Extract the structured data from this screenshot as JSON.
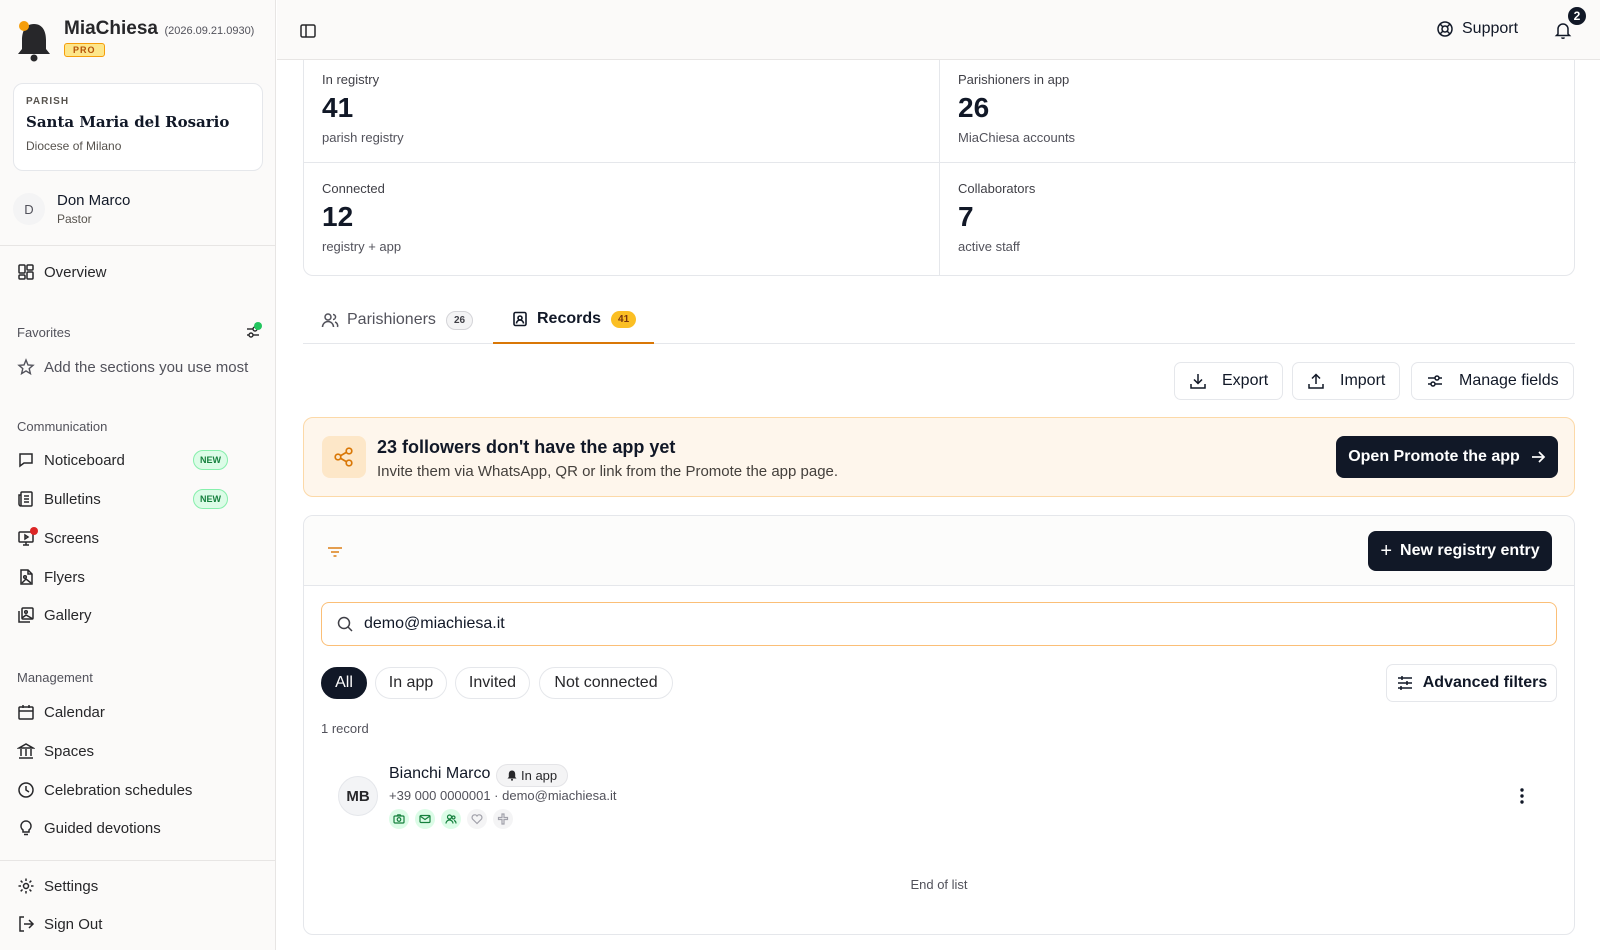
{
  "brand": {
    "name": "MiaChiesa",
    "version": "(2026.09.21.0930)",
    "tier": "PRO"
  },
  "parish": {
    "kicker": "PARISH",
    "name": "Santa Maria del Rosario",
    "diocese": "Diocese of Milano"
  },
  "user": {
    "initial": "D",
    "name": "Don Marco",
    "role": "Pastor"
  },
  "sidebar": {
    "overview": "Overview",
    "favorites": {
      "title": "Favorites",
      "placeholder": "Add the sections you use most"
    },
    "communication": {
      "title": "Communication",
      "items": [
        {
          "label": "Noticeboard",
          "badge": "NEW",
          "icon": "message-square-icon"
        },
        {
          "label": "Bulletins",
          "badge": "NEW",
          "icon": "newspaper-icon"
        },
        {
          "label": "Screens",
          "icon": "monitor-play-icon",
          "dot": true
        },
        {
          "label": "Flyers",
          "icon": "file-image-icon"
        },
        {
          "label": "Gallery",
          "icon": "images-icon"
        }
      ]
    },
    "management": {
      "title": "Management",
      "items": [
        {
          "label": "Calendar",
          "icon": "calendar-icon"
        },
        {
          "label": "Spaces",
          "icon": "landmark-icon"
        },
        {
          "label": "Celebration schedules",
          "icon": "clock-icon"
        },
        {
          "label": "Guided devotions",
          "icon": "lightbulb-icon"
        }
      ]
    },
    "settings": "Settings",
    "sign_out": "Sign Out"
  },
  "topbar": {
    "support": "Support",
    "notifications_count": "2"
  },
  "stats": [
    {
      "label": "In registry",
      "value": "41",
      "sub": "parish registry"
    },
    {
      "label": "Parishioners in app",
      "value": "26",
      "sub": "MiaChiesa accounts"
    },
    {
      "label": "Connected",
      "value": "12",
      "sub": "registry + app"
    },
    {
      "label": "Collaborators",
      "value": "7",
      "sub": "active staff"
    }
  ],
  "tabs": [
    {
      "label": "Parishioners",
      "count": "26",
      "active": false
    },
    {
      "label": "Records",
      "count": "41",
      "active": true
    }
  ],
  "actions": {
    "export": "Export",
    "import": "Import",
    "manage_fields": "Manage fields"
  },
  "promo": {
    "title": "23 followers don't have the app yet",
    "subtitle": "Invite them via WhatsApp, QR or link from the Promote the app page.",
    "cta": "Open Promote the app"
  },
  "list": {
    "new_entry": "New registry entry",
    "search_value": "demo@miachiesa.it",
    "chips": [
      "All",
      "In app",
      "Invited",
      "Not connected"
    ],
    "active_chip": "All",
    "advanced_filters": "Advanced filters",
    "record_count": "1 record",
    "end_label": "End of list",
    "rows": [
      {
        "initials": "MB",
        "name": "Bianchi Marco",
        "badge": "In app",
        "contact": "+39 000 0000001 · demo@miachiesa.it",
        "status_icons": [
          {
            "icon": "camera-icon",
            "active": true
          },
          {
            "icon": "mail-icon",
            "active": true
          },
          {
            "icon": "users-icon",
            "active": true
          },
          {
            "icon": "heart-icon",
            "active": false
          },
          {
            "icon": "cross-icon",
            "active": false
          }
        ]
      }
    ]
  },
  "colors": {
    "accent": "#d97706",
    "primary_dark": "#111827",
    "promo_bg": "#fef6ec",
    "success": "#15803d",
    "notify_red": "#dc2626"
  }
}
